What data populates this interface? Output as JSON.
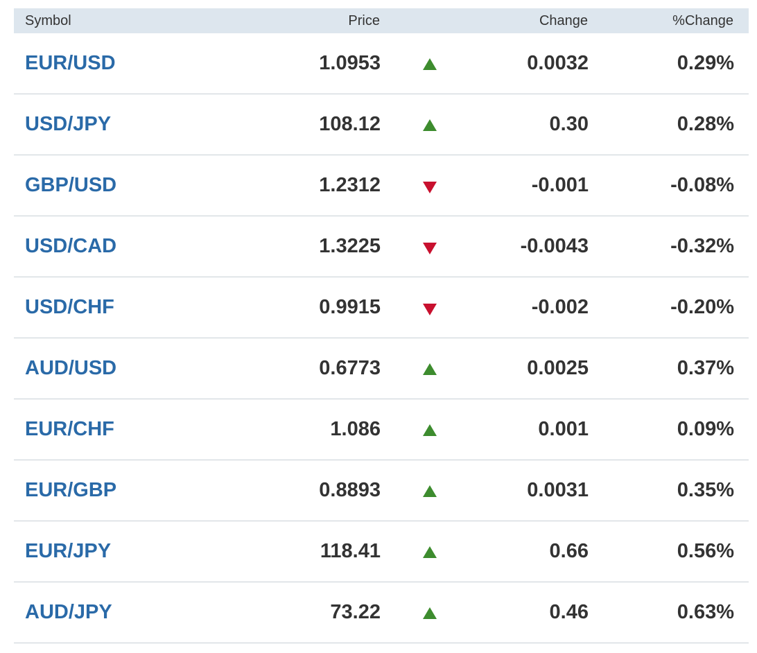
{
  "header": {
    "symbol": "Symbol",
    "price": "Price",
    "change": "Change",
    "pct_change": "%Change"
  },
  "colors": {
    "symbol_link": "#2a6aa8",
    "up": "#3d8c2e",
    "down": "#c8102e",
    "header_bg": "#dde6ee"
  },
  "rows": [
    {
      "symbol": "EUR/USD",
      "price": "1.0953",
      "direction": "up",
      "direction_icon": "up-triangle-icon",
      "change": "0.0032",
      "pct_change": "0.29%"
    },
    {
      "symbol": "USD/JPY",
      "price": "108.12",
      "direction": "up",
      "direction_icon": "up-triangle-icon",
      "change": "0.30",
      "pct_change": "0.28%"
    },
    {
      "symbol": "GBP/USD",
      "price": "1.2312",
      "direction": "down",
      "direction_icon": "down-triangle-icon",
      "change": "-0.001",
      "pct_change": "-0.08%"
    },
    {
      "symbol": "USD/CAD",
      "price": "1.3225",
      "direction": "down",
      "direction_icon": "down-triangle-icon",
      "change": "-0.0043",
      "pct_change": "-0.32%"
    },
    {
      "symbol": "USD/CHF",
      "price": "0.9915",
      "direction": "down",
      "direction_icon": "down-triangle-icon",
      "change": "-0.002",
      "pct_change": "-0.20%"
    },
    {
      "symbol": "AUD/USD",
      "price": "0.6773",
      "direction": "up",
      "direction_icon": "up-triangle-icon",
      "change": "0.0025",
      "pct_change": "0.37%"
    },
    {
      "symbol": "EUR/CHF",
      "price": "1.086",
      "direction": "up",
      "direction_icon": "up-triangle-icon",
      "change": "0.001",
      "pct_change": "0.09%"
    },
    {
      "symbol": "EUR/GBP",
      "price": "0.8893",
      "direction": "up",
      "direction_icon": "up-triangle-icon",
      "change": "0.0031",
      "pct_change": "0.35%"
    },
    {
      "symbol": "EUR/JPY",
      "price": "118.41",
      "direction": "up",
      "direction_icon": "up-triangle-icon",
      "change": "0.66",
      "pct_change": "0.56%"
    },
    {
      "symbol": "AUD/JPY",
      "price": "73.22",
      "direction": "up",
      "direction_icon": "up-triangle-icon",
      "change": "0.46",
      "pct_change": "0.63%"
    }
  ]
}
